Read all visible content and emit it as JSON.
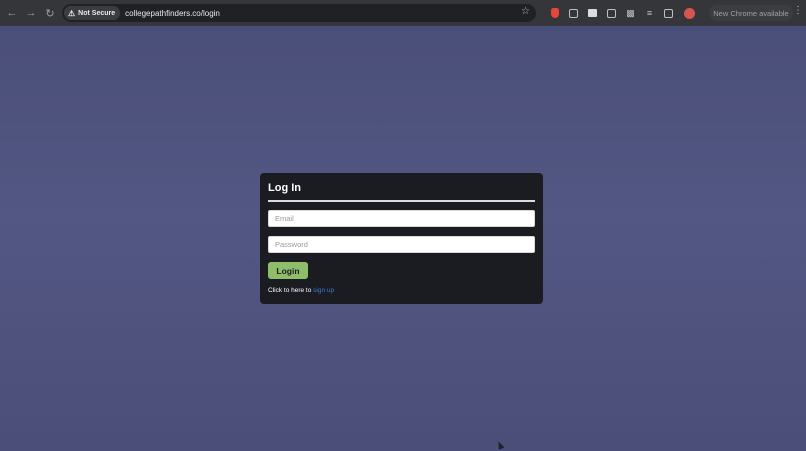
{
  "browser": {
    "security_label": "Not Secure",
    "url": "collegepathfinders.co/login",
    "update_label": "New Chrome available"
  },
  "icons": {
    "back": "back-arrow-icon",
    "forward": "forward-arrow-icon",
    "reload": "reload-icon",
    "warning": "warning-icon",
    "bookmark": "star-icon",
    "menu": "more-vert-icon"
  },
  "login": {
    "title": "Log In",
    "email_placeholder": "Email",
    "password_placeholder": "Password",
    "button_label": "Login",
    "signup_prefix": "Click to here to",
    "signup_link": "sign up"
  },
  "colors": {
    "page_background": "#4b4f78",
    "card_background": "#1b1c22",
    "button_background": "#8fbe6a",
    "link": "#3a7bd5"
  }
}
